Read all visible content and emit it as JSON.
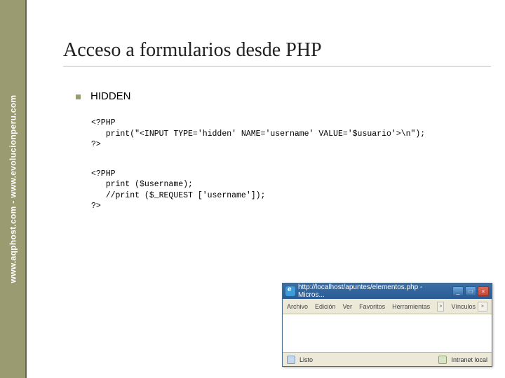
{
  "sidebar": {
    "text": "www.aqphost.com - www.evolucionperu.com"
  },
  "slide": {
    "title": "Acceso a formularios desde PHP",
    "section_label": "HIDDEN",
    "code1": "<?PHP\n   print(\"<INPUT TYPE='hidden' NAME='username' VALUE='$usuario'>\\n\");\n?>",
    "code2": "<?PHP\n   print ($username);\n   //print ($_REQUEST ['username']);\n?>"
  },
  "browser": {
    "title": "http://localhost/apuntes/elementos.php - Micros...",
    "menu": [
      "Archivo",
      "Edición",
      "Ver",
      "Favoritos",
      "Herramientas"
    ],
    "menu_extra": "Vínculos",
    "status_ready": "Listo",
    "status_zone": "Intranet local"
  }
}
